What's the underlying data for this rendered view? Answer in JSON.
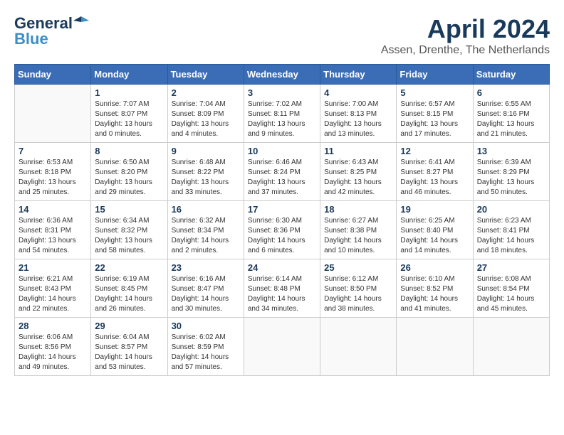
{
  "header": {
    "logo_general": "General",
    "logo_blue": "Blue",
    "month": "April 2024",
    "location": "Assen, Drenthe, The Netherlands"
  },
  "weekdays": [
    "Sunday",
    "Monday",
    "Tuesday",
    "Wednesday",
    "Thursday",
    "Friday",
    "Saturday"
  ],
  "weeks": [
    [
      {
        "day": "",
        "sunrise": "",
        "sunset": "",
        "daylight": ""
      },
      {
        "day": "1",
        "sunrise": "Sunrise: 7:07 AM",
        "sunset": "Sunset: 8:07 PM",
        "daylight": "Daylight: 13 hours and 0 minutes."
      },
      {
        "day": "2",
        "sunrise": "Sunrise: 7:04 AM",
        "sunset": "Sunset: 8:09 PM",
        "daylight": "Daylight: 13 hours and 4 minutes."
      },
      {
        "day": "3",
        "sunrise": "Sunrise: 7:02 AM",
        "sunset": "Sunset: 8:11 PM",
        "daylight": "Daylight: 13 hours and 9 minutes."
      },
      {
        "day": "4",
        "sunrise": "Sunrise: 7:00 AM",
        "sunset": "Sunset: 8:13 PM",
        "daylight": "Daylight: 13 hours and 13 minutes."
      },
      {
        "day": "5",
        "sunrise": "Sunrise: 6:57 AM",
        "sunset": "Sunset: 8:15 PM",
        "daylight": "Daylight: 13 hours and 17 minutes."
      },
      {
        "day": "6",
        "sunrise": "Sunrise: 6:55 AM",
        "sunset": "Sunset: 8:16 PM",
        "daylight": "Daylight: 13 hours and 21 minutes."
      }
    ],
    [
      {
        "day": "7",
        "sunrise": "Sunrise: 6:53 AM",
        "sunset": "Sunset: 8:18 PM",
        "daylight": "Daylight: 13 hours and 25 minutes."
      },
      {
        "day": "8",
        "sunrise": "Sunrise: 6:50 AM",
        "sunset": "Sunset: 8:20 PM",
        "daylight": "Daylight: 13 hours and 29 minutes."
      },
      {
        "day": "9",
        "sunrise": "Sunrise: 6:48 AM",
        "sunset": "Sunset: 8:22 PM",
        "daylight": "Daylight: 13 hours and 33 minutes."
      },
      {
        "day": "10",
        "sunrise": "Sunrise: 6:46 AM",
        "sunset": "Sunset: 8:24 PM",
        "daylight": "Daylight: 13 hours and 37 minutes."
      },
      {
        "day": "11",
        "sunrise": "Sunrise: 6:43 AM",
        "sunset": "Sunset: 8:25 PM",
        "daylight": "Daylight: 13 hours and 42 minutes."
      },
      {
        "day": "12",
        "sunrise": "Sunrise: 6:41 AM",
        "sunset": "Sunset: 8:27 PM",
        "daylight": "Daylight: 13 hours and 46 minutes."
      },
      {
        "day": "13",
        "sunrise": "Sunrise: 6:39 AM",
        "sunset": "Sunset: 8:29 PM",
        "daylight": "Daylight: 13 hours and 50 minutes."
      }
    ],
    [
      {
        "day": "14",
        "sunrise": "Sunrise: 6:36 AM",
        "sunset": "Sunset: 8:31 PM",
        "daylight": "Daylight: 13 hours and 54 minutes."
      },
      {
        "day": "15",
        "sunrise": "Sunrise: 6:34 AM",
        "sunset": "Sunset: 8:32 PM",
        "daylight": "Daylight: 13 hours and 58 minutes."
      },
      {
        "day": "16",
        "sunrise": "Sunrise: 6:32 AM",
        "sunset": "Sunset: 8:34 PM",
        "daylight": "Daylight: 14 hours and 2 minutes."
      },
      {
        "day": "17",
        "sunrise": "Sunrise: 6:30 AM",
        "sunset": "Sunset: 8:36 PM",
        "daylight": "Daylight: 14 hours and 6 minutes."
      },
      {
        "day": "18",
        "sunrise": "Sunrise: 6:27 AM",
        "sunset": "Sunset: 8:38 PM",
        "daylight": "Daylight: 14 hours and 10 minutes."
      },
      {
        "day": "19",
        "sunrise": "Sunrise: 6:25 AM",
        "sunset": "Sunset: 8:40 PM",
        "daylight": "Daylight: 14 hours and 14 minutes."
      },
      {
        "day": "20",
        "sunrise": "Sunrise: 6:23 AM",
        "sunset": "Sunset: 8:41 PM",
        "daylight": "Daylight: 14 hours and 18 minutes."
      }
    ],
    [
      {
        "day": "21",
        "sunrise": "Sunrise: 6:21 AM",
        "sunset": "Sunset: 8:43 PM",
        "daylight": "Daylight: 14 hours and 22 minutes."
      },
      {
        "day": "22",
        "sunrise": "Sunrise: 6:19 AM",
        "sunset": "Sunset: 8:45 PM",
        "daylight": "Daylight: 14 hours and 26 minutes."
      },
      {
        "day": "23",
        "sunrise": "Sunrise: 6:16 AM",
        "sunset": "Sunset: 8:47 PM",
        "daylight": "Daylight: 14 hours and 30 minutes."
      },
      {
        "day": "24",
        "sunrise": "Sunrise: 6:14 AM",
        "sunset": "Sunset: 8:48 PM",
        "daylight": "Daylight: 14 hours and 34 minutes."
      },
      {
        "day": "25",
        "sunrise": "Sunrise: 6:12 AM",
        "sunset": "Sunset: 8:50 PM",
        "daylight": "Daylight: 14 hours and 38 minutes."
      },
      {
        "day": "26",
        "sunrise": "Sunrise: 6:10 AM",
        "sunset": "Sunset: 8:52 PM",
        "daylight": "Daylight: 14 hours and 41 minutes."
      },
      {
        "day": "27",
        "sunrise": "Sunrise: 6:08 AM",
        "sunset": "Sunset: 8:54 PM",
        "daylight": "Daylight: 14 hours and 45 minutes."
      }
    ],
    [
      {
        "day": "28",
        "sunrise": "Sunrise: 6:06 AM",
        "sunset": "Sunset: 8:56 PM",
        "daylight": "Daylight: 14 hours and 49 minutes."
      },
      {
        "day": "29",
        "sunrise": "Sunrise: 6:04 AM",
        "sunset": "Sunset: 8:57 PM",
        "daylight": "Daylight: 14 hours and 53 minutes."
      },
      {
        "day": "30",
        "sunrise": "Sunrise: 6:02 AM",
        "sunset": "Sunset: 8:59 PM",
        "daylight": "Daylight: 14 hours and 57 minutes."
      },
      {
        "day": "",
        "sunrise": "",
        "sunset": "",
        "daylight": ""
      },
      {
        "day": "",
        "sunrise": "",
        "sunset": "",
        "daylight": ""
      },
      {
        "day": "",
        "sunrise": "",
        "sunset": "",
        "daylight": ""
      },
      {
        "day": "",
        "sunrise": "",
        "sunset": "",
        "daylight": ""
      }
    ]
  ]
}
